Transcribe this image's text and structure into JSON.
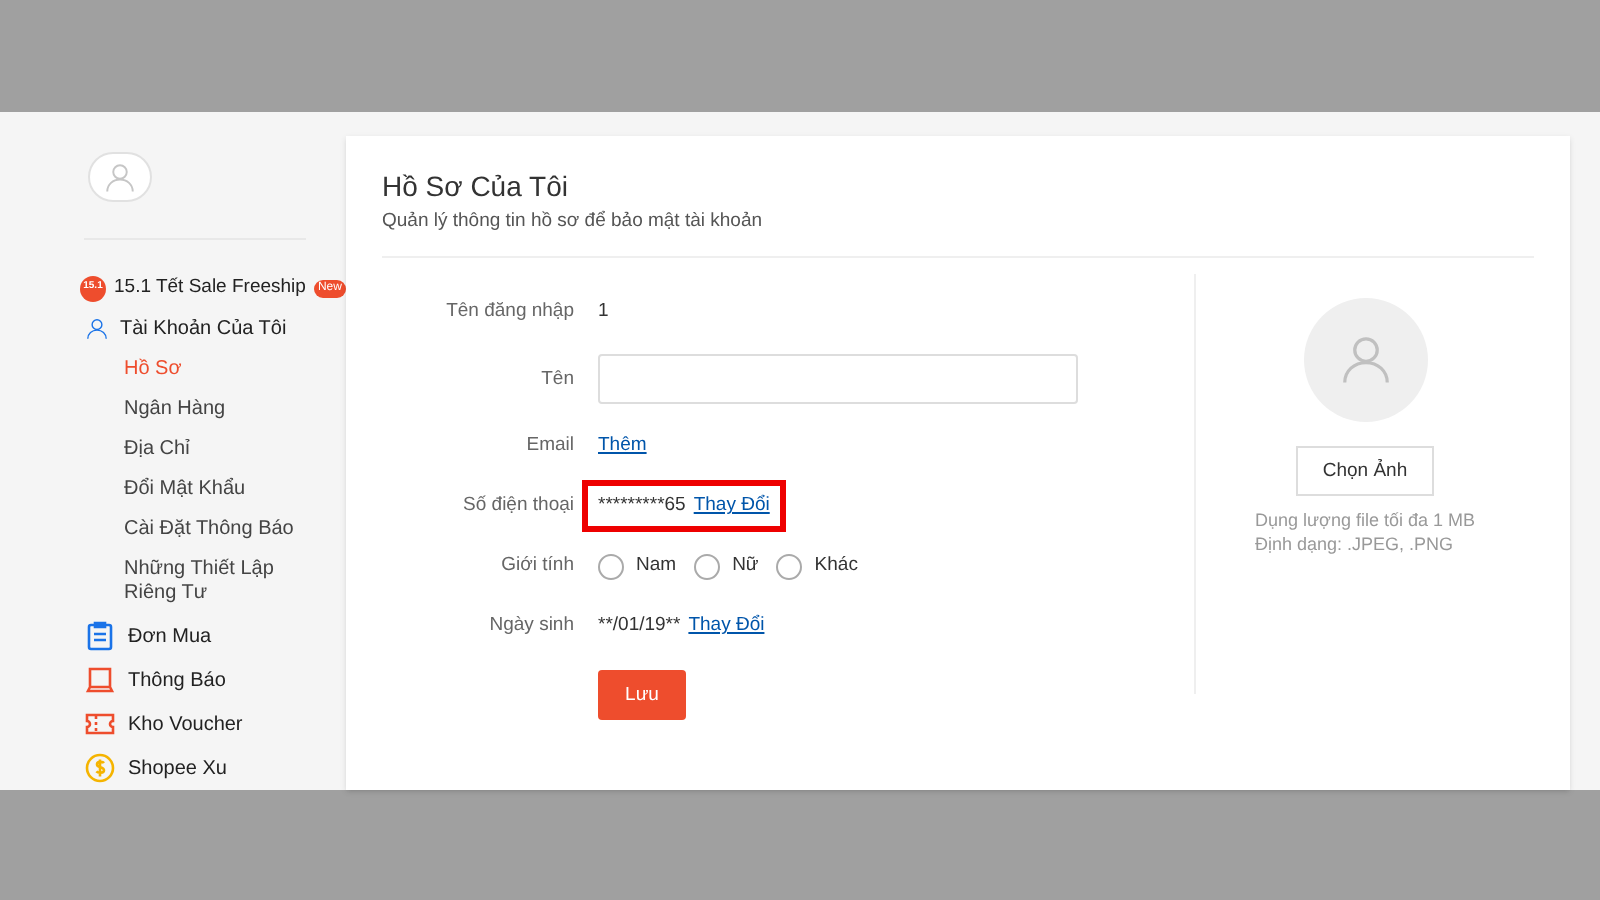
{
  "sidebar": {
    "promo": {
      "badge": "15.1",
      "label": "15.1 Tết Sale Freeship",
      "tag": "New"
    },
    "account": {
      "label": "Tài Khoản Của Tôi",
      "children": [
        {
          "label": "Hồ Sơ",
          "selected": true
        },
        {
          "label": "Ngân Hàng",
          "selected": false
        },
        {
          "label": "Địa Chỉ",
          "selected": false
        },
        {
          "label": "Đổi Mật Khẩu",
          "selected": false
        },
        {
          "label": "Cài Đặt Thông Báo",
          "selected": false
        },
        {
          "label": "Những Thiết Lập Riêng Tư",
          "selected": false
        }
      ]
    },
    "items": [
      {
        "kind": "orders",
        "label": "Đơn Mua"
      },
      {
        "kind": "notifications",
        "label": "Thông Báo"
      },
      {
        "kind": "voucher",
        "label": "Kho Voucher"
      },
      {
        "kind": "coins",
        "label": "Shopee Xu"
      }
    ]
  },
  "profile": {
    "title": "Hồ Sơ Của Tôi",
    "subtitle": "Quản lý thông tin hồ sơ để bảo mật tài khoản",
    "fields": [
      {
        "kind": "text",
        "label": "Tên đăng nhập",
        "value": "1"
      },
      {
        "kind": "input",
        "label": "Tên"
      },
      {
        "kind": "link",
        "label": "Email",
        "link": "Thêm"
      },
      {
        "kind": "text",
        "label": "Số điện thoại",
        "value": "*********65",
        "link": "Thay Đổi",
        "highlighted": true
      },
      {
        "kind": "radio",
        "label": "Giới tính",
        "options": [
          {
            "label": "Nam",
            "selected": false
          },
          {
            "label": "Nữ",
            "selected": false
          },
          {
            "label": "Khác",
            "selected": false
          }
        ]
      },
      {
        "kind": "text",
        "label": "Ngày sinh",
        "value": "**/01/19**",
        "link": "Thay Đổi",
        "highlighted": false
      }
    ],
    "save_button": "Lưu",
    "avatar": {
      "button": "Chọn Ảnh",
      "notes": [
        "Dụng lượng file tối đa 1 MB",
        "Định dạng: .JPEG, .PNG"
      ]
    }
  }
}
